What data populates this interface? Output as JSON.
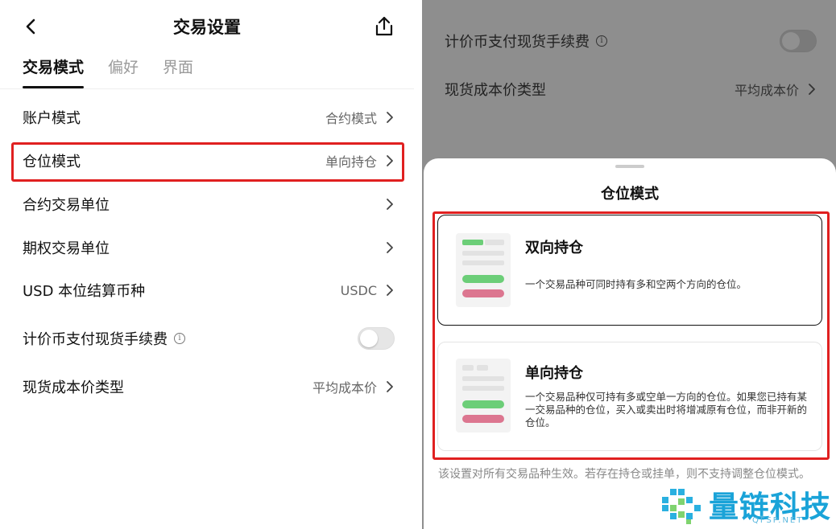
{
  "left": {
    "header": {
      "title": "交易设置"
    },
    "tabs": [
      {
        "label": "交易模式",
        "active": true
      },
      {
        "label": "偏好",
        "active": false
      },
      {
        "label": "界面",
        "active": false
      }
    ],
    "rows": [
      {
        "label": "账户模式",
        "value": "合约模式"
      },
      {
        "label": "仓位模式",
        "value": "单向持仓"
      },
      {
        "label": "合约交易单位",
        "value": ""
      },
      {
        "label": "期权交易单位",
        "value": ""
      },
      {
        "label": "USD 本位结算币种",
        "value": "USDC"
      },
      {
        "label": "计价币支付现货手续费",
        "toggle": false
      },
      {
        "label": "现货成本价类型",
        "value": "平均成本价"
      }
    ]
  },
  "right": {
    "rows": [
      {
        "label": "计价币支付现货手续费",
        "toggle": false
      },
      {
        "label": "现货成本价类型",
        "value": "平均成本价"
      }
    ],
    "sheet": {
      "title": "仓位模式",
      "options": [
        {
          "title": "双向持仓",
          "desc": "一个交易品种可同时持有多和空两个方向的仓位。",
          "selected": true
        },
        {
          "title": "单向持仓",
          "desc": "一个交易品种仅可持有多或空单一方向的仓位。如果您已持有某一交易品种的仓位，买入或卖出时将增减原有仓位，而非开新的仓位。",
          "selected": false
        }
      ],
      "footnote": "该设置对所有交易品种生效。若存在持仓或挂单，则不支持调整仓位模式。"
    }
  },
  "watermark": {
    "text": "量链科技",
    "sub": "QFSP.NET"
  },
  "colors": {
    "highlight": "#e02020",
    "green": "#6cce78",
    "pink": "#dc7690",
    "overlay": "#8e8e8e",
    "watermark": "#1aa3d8"
  },
  "icons": {
    "back": "chevron-left-icon",
    "share": "share-icon",
    "chevron": "chevron-right-icon",
    "info": "info-icon"
  }
}
